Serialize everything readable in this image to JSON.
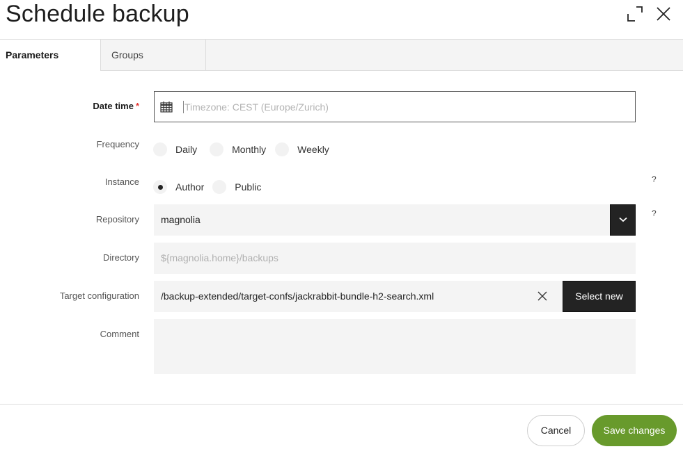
{
  "dialog": {
    "title": "Schedule backup",
    "maximize_icon": "maximize-icon",
    "close_icon": "close-icon"
  },
  "tabs": [
    {
      "label": "Parameters",
      "active": true
    },
    {
      "label": "Groups",
      "active": false
    }
  ],
  "form": {
    "date_time": {
      "label": "Date time",
      "required_marker": "*",
      "icon": "calendar-icon",
      "placeholder": "Timezone: CEST (Europe/Zurich)",
      "value": ""
    },
    "frequency": {
      "label": "Frequency",
      "options": [
        "Daily",
        "Monthly",
        "Weekly"
      ],
      "selected": null
    },
    "instance": {
      "label": "Instance",
      "options": [
        "Author",
        "Public"
      ],
      "selected": "Author",
      "help": "?"
    },
    "repository": {
      "label": "Repository",
      "value": "magnolia",
      "help": "?",
      "dropdown_icon": "chevron-down-icon"
    },
    "directory": {
      "label": "Directory",
      "placeholder": "${magnolia.home}/backups",
      "value": ""
    },
    "target_configuration": {
      "label": "Target configuration",
      "value": "/backup-extended/target-confs/jackrabbit-bundle-h2-search.xml",
      "clear_icon": "clear-icon",
      "select_new_label": "Select new"
    },
    "comment": {
      "label": "Comment",
      "value": ""
    }
  },
  "footer": {
    "cancel_label": "Cancel",
    "save_label": "Save changes"
  },
  "colors": {
    "primary": "#689a2c",
    "dark_button": "#232323",
    "required": "#e53935",
    "field_bg": "#f4f4f4"
  }
}
